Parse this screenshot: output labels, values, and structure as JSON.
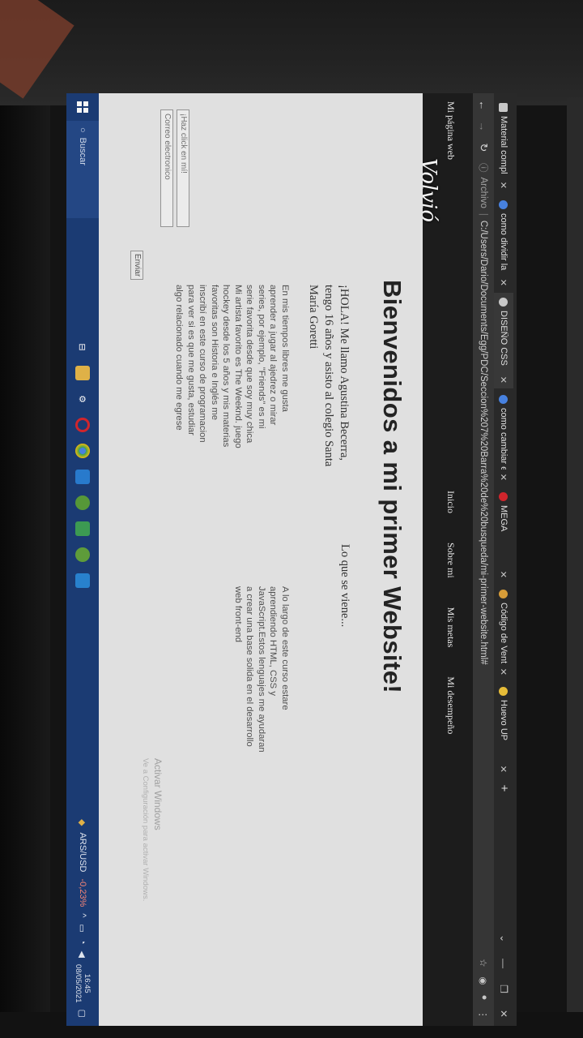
{
  "browser": {
    "tabs": [
      {
        "title": "Material compl",
        "icon": "document-icon",
        "color": "#d0d0d0",
        "active": false
      },
      {
        "title": "como dividir la",
        "icon": "google-icon",
        "color": "#d0d0d0",
        "active": false
      },
      {
        "title": "DISEÑO CSS",
        "icon": "chrome-icon",
        "color": "#d0d0d0",
        "active": true
      },
      {
        "title": "como cambiar e",
        "icon": "google-icon",
        "color": "#d0d0d0",
        "active": false
      },
      {
        "title": "MEGA",
        "icon": "mega-icon",
        "color": "#d9272e",
        "active": false
      },
      {
        "title": "Código de Vent",
        "icon": "code-icon",
        "color": "#e0a33a",
        "active": false
      },
      {
        "title": "Huevo UP",
        "icon": "egg-icon",
        "color": "#f0c43a",
        "active": false
      }
    ],
    "address": {
      "scheme_label": "Archivo",
      "url": "C:/Users/Dario/Documents/Egg/PDC/Seccion%207%20Barra%20de%20busqueda/mi-primer-website.html#"
    }
  },
  "site": {
    "brand": "Mi página web",
    "nav_links": [
      "Inicio",
      "Sobre mi",
      "Mis metas",
      "Mi desempeño"
    ],
    "hero_title": "Bienvenidos a mi primer Website!",
    "intro": "¡HOLA! Me llamo Agustina Becerra, tengo 16 años y asisto al colegio Santa María Goretti",
    "bio": "En mis tiempos libres me gusta aprender a jugar al ajedrez o mirar series, por ejemplo, \"Friends\" es mi serie favorita desde que soy muy chica Mi artista favorito es The Weeknd. juego hockey desde los 5 años y mis materias favoritas son Historia e Inglés me inscribí en este curso de programacion para ver si es que me gusta, estudiar algo relacionado cuando me egrese",
    "coming_title": "Lo que se viene...",
    "coming_text": "A lo largo de este curso estare aprendiendo HTML, CSS y JavaScript.Estos lenguajes me ayudaran a crear una base solida en el desarrollo web front-end",
    "form": {
      "field1_placeholder": "¡Haz click en mí!",
      "field2_placeholder": "Correo electronico",
      "submit_label": "Enviar"
    },
    "activate_windows": "Activar Windows",
    "activate_windows_sub": "Ve a Configuración para activar Windows."
  },
  "overlay": {
    "watermark": "Volvió"
  },
  "taskbar": {
    "search_label": "Buscar",
    "currency": "ARS/USD",
    "currency_change": "-0,23%",
    "time": "16:45",
    "date": "08/05/2021",
    "apps": [
      {
        "icon": "task-view-icon",
        "color": "#1c3d78"
      },
      {
        "icon": "file-explorer-icon",
        "color": "#e8b84a"
      },
      {
        "icon": "settings-icon",
        "color": "#1c3d78"
      },
      {
        "icon": "opera-icon",
        "color": "#d9272e"
      },
      {
        "icon": "chrome-icon",
        "color": "#3aa757"
      },
      {
        "icon": "store-icon",
        "color": "#2a7fd4"
      },
      {
        "icon": "app-green-icon",
        "color": "#5a9e3a"
      },
      {
        "icon": "app-lime-icon",
        "color": "#3ea055"
      },
      {
        "icon": "app-green2-icon",
        "color": "#62a33c"
      },
      {
        "icon": "vscode-icon",
        "color": "#2a86d6"
      }
    ]
  }
}
